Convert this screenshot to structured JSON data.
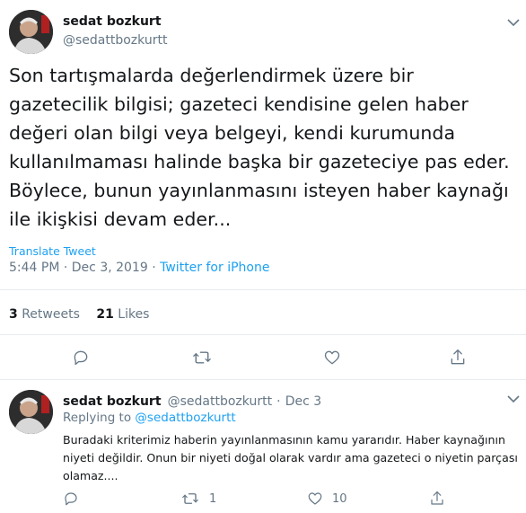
{
  "main_tweet": {
    "author_name": "sedat bozkurt",
    "author_handle": "@sedattbozkurtt",
    "text": "Son tartışmalarda değerlendirmek üzere bir gazetecilik bilgisi; gazeteci kendisine gelen haber değeri olan bilgi veya belgeyi, kendi kurumunda kullanılmaması halinde başka bir gazeteciye pas eder. Böylece, bunun yayınlanmasını isteyen haber kaynağı ile ikişkisi devam eder...",
    "translate_label": "Translate Tweet",
    "time": "5:44 PM",
    "date": "Dec 3, 2019",
    "separator": "·",
    "source": "Twitter for iPhone",
    "retweets_count": "3",
    "retweets_label": "Retweets",
    "likes_count": "21",
    "likes_label": "Likes"
  },
  "reply_tweet": {
    "author_name": "sedat bozkurt",
    "author_handle": "@sedattbozkurtt",
    "separator": "·",
    "date": "Dec 3",
    "replying_label": "Replying to",
    "replying_handle": "@sedattbozkurtt",
    "text": "Buradaki kriterimiz haberin yayınlanmasının kamu yararıdır. Haber kaynağının niyeti değildir. Onun bir niyeti doğal olarak vardır ama gazeteci o niyetin parçası olamaz....",
    "retweet_count": "1",
    "like_count": "10"
  },
  "icons": {
    "more": "chevron-down-icon",
    "reply": "reply-icon",
    "retweet": "retweet-icon",
    "like": "heart-icon",
    "share": "share-icon"
  },
  "colors": {
    "accent": "#1da1f2",
    "secondary_text": "#657786",
    "divider": "#e6ecf0"
  }
}
